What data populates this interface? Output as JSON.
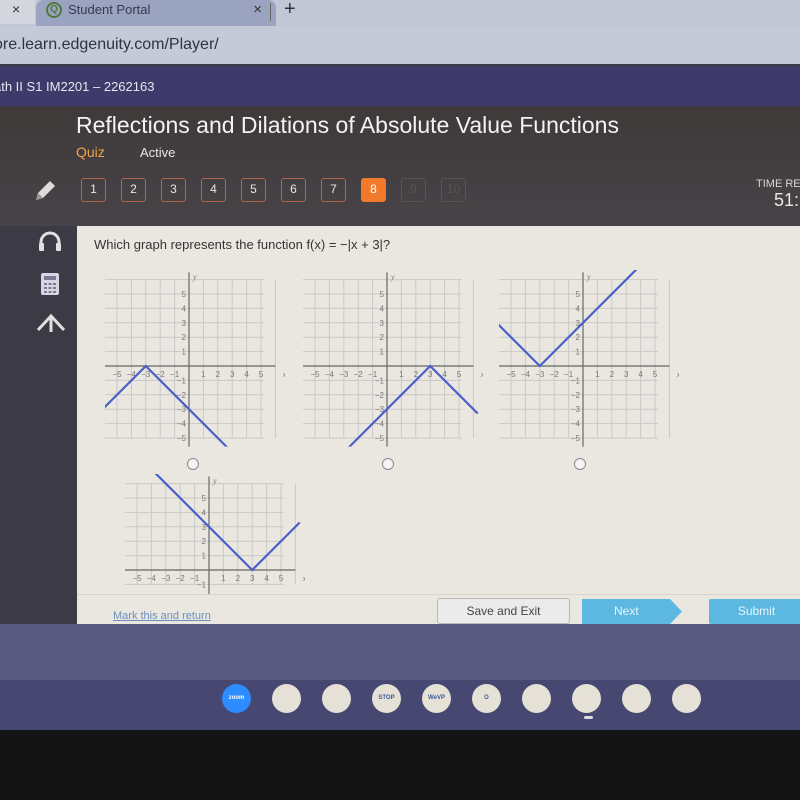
{
  "browser": {
    "prev_tab_close": "×",
    "tab_title": "Student Portal",
    "tab_close": "×",
    "new_tab": "+",
    "favicon": "Q",
    "url": "ore.learn.edgenuity.com/Player/"
  },
  "course": {
    "name": "ath II S1 IM2201 – 2262163"
  },
  "header": {
    "title": "Reflections and Dilations of Absolute Value Functions",
    "type": "Quiz",
    "status": "Active",
    "time_label": "TIME REMAINING",
    "time_value": "51:"
  },
  "question_nav": [
    {
      "label": "1",
      "state": "answered"
    },
    {
      "label": "2",
      "state": "answered"
    },
    {
      "label": "3",
      "state": "answered"
    },
    {
      "label": "4",
      "state": "answered"
    },
    {
      "label": "5",
      "state": "answered"
    },
    {
      "label": "6",
      "state": "answered"
    },
    {
      "label": "7",
      "state": "answered"
    },
    {
      "label": "8",
      "state": "current"
    },
    {
      "label": "9",
      "state": "disabled"
    },
    {
      "label": "10",
      "state": "disabled"
    }
  ],
  "tools": [
    "pencil-icon",
    "headphones-icon",
    "calculator-icon",
    "reference-icon"
  ],
  "question": {
    "text": "Which graph represents the function f(x) = −|x + 3|?"
  },
  "graphs": [
    {
      "id": "A",
      "vertex": [
        -3,
        0
      ],
      "opens": "down",
      "x_tick_labels": [
        "−5",
        "−4",
        "−3",
        "−2",
        "−1",
        "1",
        "2",
        "3",
        "4",
        "5"
      ],
      "y_tick_labels": [
        "5",
        "4",
        "3",
        "2",
        "1",
        "−1",
        "−2",
        "−3",
        "−4",
        "−5"
      ],
      "x_label": "x",
      "y_label": "y",
      "selected": false
    },
    {
      "id": "B",
      "vertex": [
        3,
        0
      ],
      "opens": "down",
      "x_tick_labels": [
        "−5",
        "−4",
        "−3",
        "−2",
        "−1",
        "1",
        "2",
        "3",
        "4",
        "5"
      ],
      "y_tick_labels": [
        "5",
        "4",
        "3",
        "2",
        "1",
        "−1",
        "−2",
        "−3",
        "−4",
        "−5"
      ],
      "x_label": "x",
      "y_label": "y",
      "selected": false
    },
    {
      "id": "C",
      "vertex": [
        -3,
        0
      ],
      "opens": "up",
      "x_tick_labels": [
        "−5",
        "−4",
        "−3",
        "−2",
        "−1",
        "1",
        "2",
        "3",
        "4",
        "5"
      ],
      "y_tick_labels": [
        "5",
        "4",
        "3",
        "2",
        "1",
        "−1",
        "−2",
        "−3",
        "−4",
        "−5"
      ],
      "x_label": "x",
      "y_label": "y",
      "selected": false
    },
    {
      "id": "D",
      "vertex": [
        3,
        0
      ],
      "opens": "up",
      "x_tick_labels": [
        "−5",
        "−4",
        "−3",
        "−2",
        "−1",
        "1",
        "2",
        "3",
        "4",
        "5"
      ],
      "y_tick_labels": [
        "5",
        "4",
        "3",
        "2",
        "1",
        "−1"
      ],
      "x_label": "x",
      "y_label": "y",
      "selected": false
    }
  ],
  "colors": {
    "line": "#4a5fc7",
    "grid": "#c9c9c9",
    "accent": "#f07a2a",
    "button_blue": "#5cb8e0"
  },
  "footer": {
    "mark_link": "Mark this and return",
    "save": "Save and Exit",
    "next": "Next",
    "submit": "Submit"
  },
  "shelf": [
    {
      "name": "zoom",
      "label": "zoom"
    },
    {
      "name": "google-drive-backup",
      "label": ""
    },
    {
      "name": "google-classroom",
      "label": ""
    },
    {
      "name": "stop-motion",
      "label": "STOP"
    },
    {
      "name": "wevideo",
      "label": "WeVP"
    },
    {
      "name": "outlook",
      "label": "O"
    },
    {
      "name": "google-drive",
      "label": ""
    },
    {
      "name": "chrome",
      "label": ""
    },
    {
      "name": "google-docs",
      "label": ""
    },
    {
      "name": "play-store",
      "label": ""
    }
  ]
}
